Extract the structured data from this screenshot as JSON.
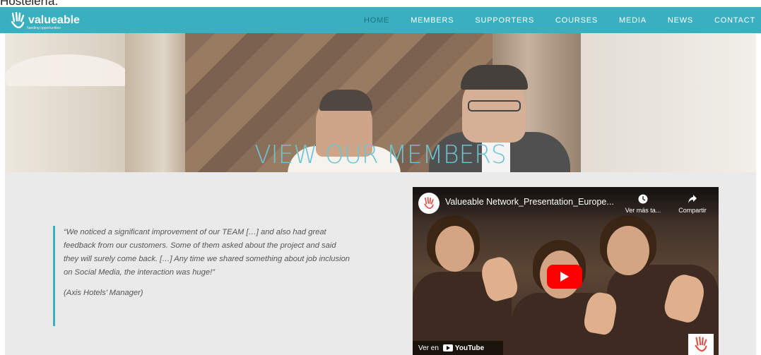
{
  "top_strip": {
    "text": "Hostelería."
  },
  "nav": {
    "logo_text": "valueable",
    "logo_tagline": "handing opportunities",
    "items": [
      "HOME",
      "MEMBERS",
      "SUPPORTERS",
      "COURSES",
      "MEDIA",
      "NEWS",
      "CONTACT"
    ],
    "active_index": 0,
    "background": "#3aafbf"
  },
  "hero": {
    "title": "VIEW OUR MEMBERS",
    "title_color": "#6fc3d1"
  },
  "testimonial": {
    "quote": "“We noticed a significant improvement of our TEAM […] and also had great feedback from our customers. Some of them asked about the project and said they will surely come back. […] Any time we shared something about job inclusion on Social Media, the interaction was huge!”",
    "author": "(Axis Hotels’ Manager)",
    "accent": "#3aafbf"
  },
  "video": {
    "title": "Valueable Network_Presentation_Europe...",
    "watch_later_label": "Ver más ta...",
    "share_label": "Compartir",
    "watch_on_label": "Ver en",
    "youtube_label": "YouTube",
    "play_color": "#ff0000"
  }
}
